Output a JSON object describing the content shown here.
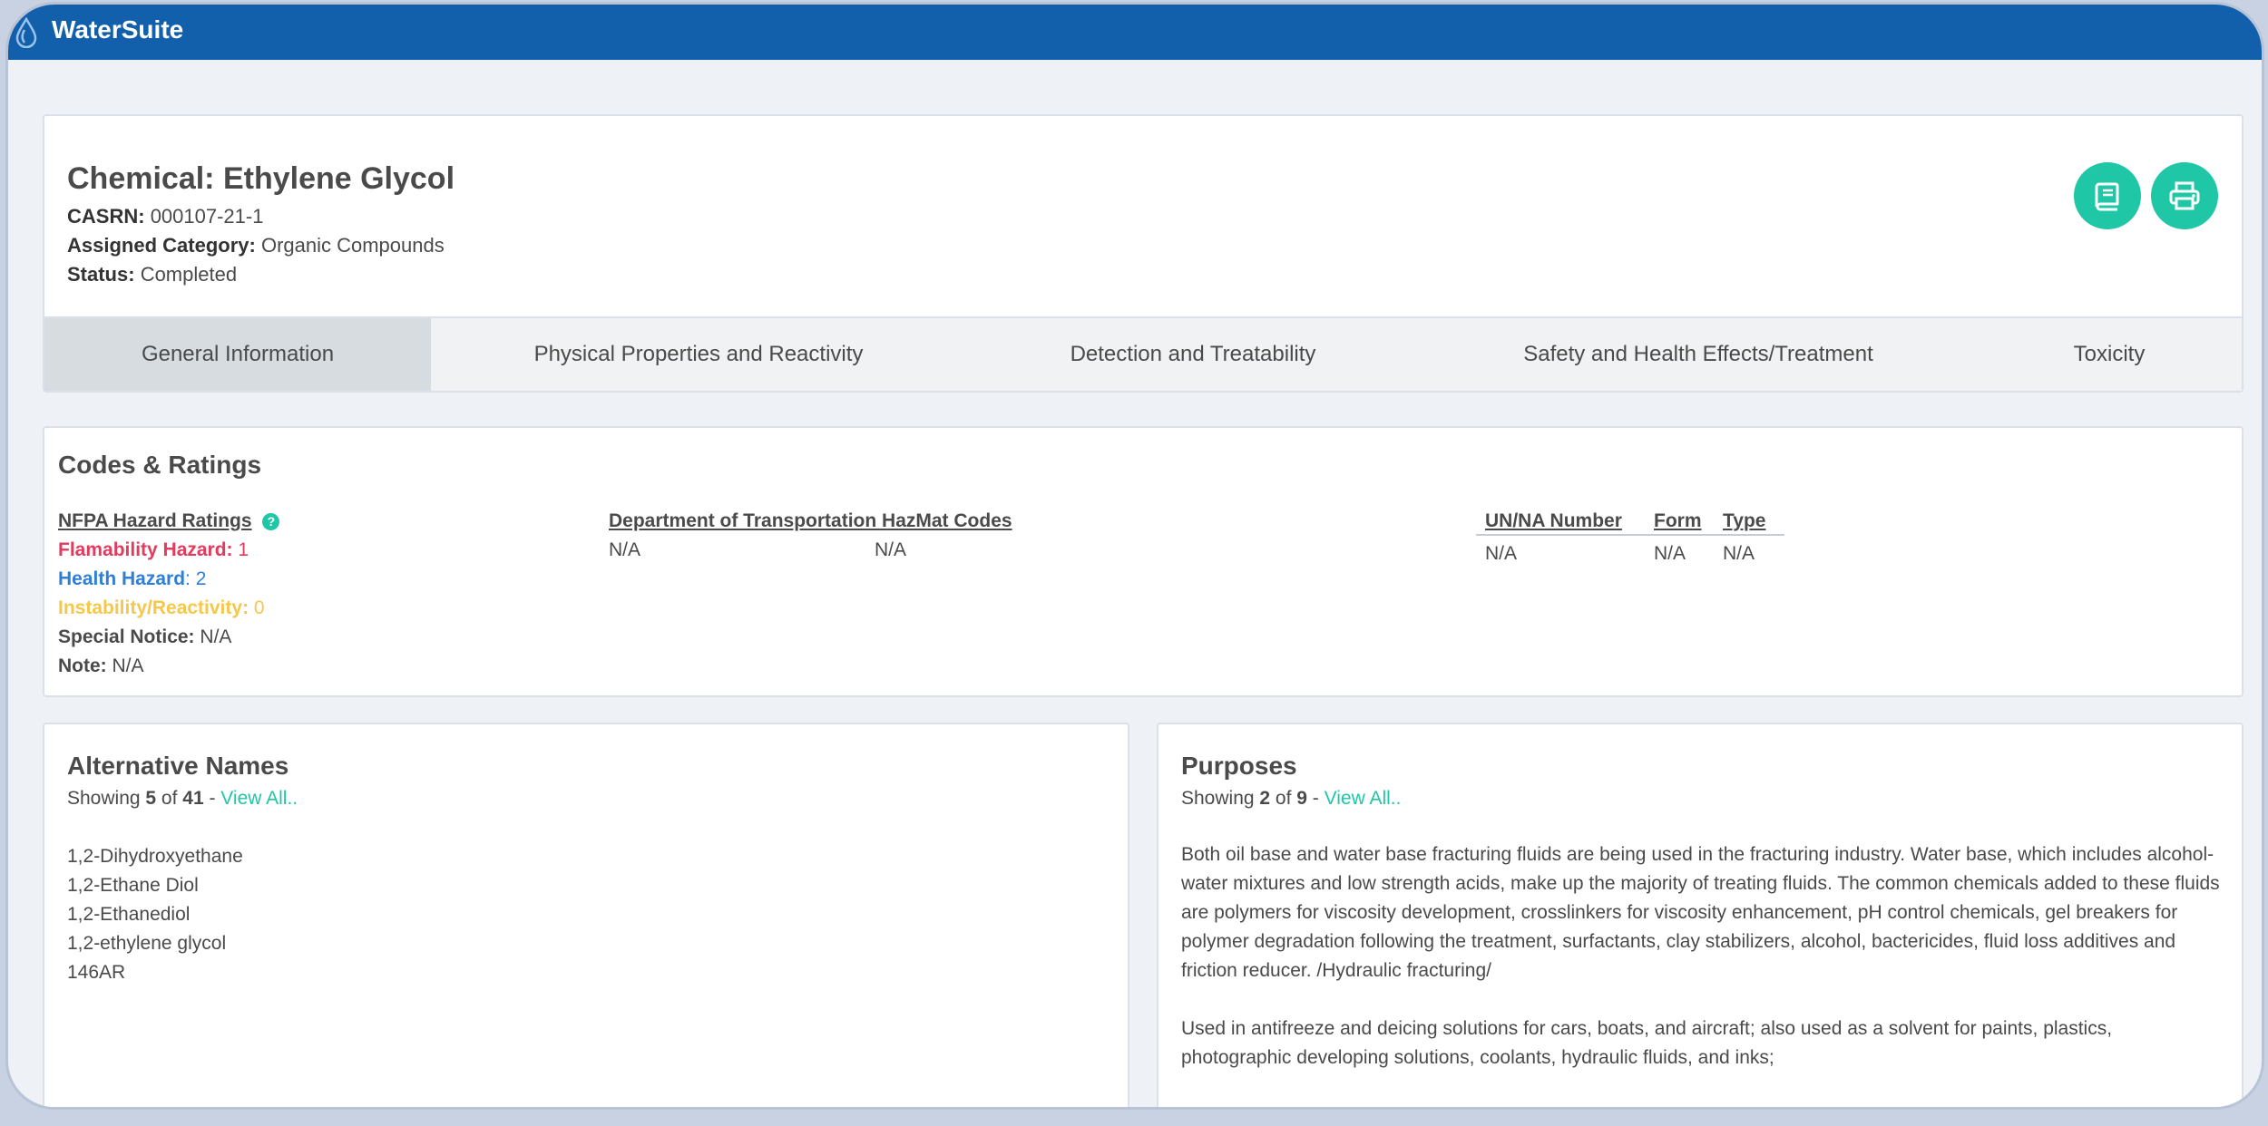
{
  "app": {
    "title": "WaterSuite"
  },
  "chemical": {
    "title": "Chemical: Ethylene Glycol",
    "casrn_label": "CASRN:",
    "casrn": "000107-21-1",
    "category_label": "Assigned Category:",
    "category": "Organic Compounds",
    "status_label": "Status:",
    "status": "Completed"
  },
  "tabs": [
    {
      "label": "General Information",
      "active": true
    },
    {
      "label": "Physical Properties and Reactivity",
      "active": false
    },
    {
      "label": "Detection and Treatability",
      "active": false
    },
    {
      "label": "Safety and Health Effects/Treatment",
      "active": false
    },
    {
      "label": "Toxicity",
      "active": false
    }
  ],
  "codes": {
    "title": "Codes & Ratings",
    "nfpa": {
      "heading": "NFPA Hazard Ratings",
      "flammability_label": "Flamability Hazard:",
      "flammability": "1",
      "health_label": "Health Hazard",
      "health": ": 2",
      "instability_label": "Instability/Reactivity:",
      "instability": "0",
      "special_label": "Special Notice:",
      "special": "N/A",
      "note_label": "Note:",
      "note": "N/A"
    },
    "dot": {
      "heading": "Department of Transportation HazMat Codes",
      "values": [
        "N/A",
        "N/A"
      ]
    },
    "un": {
      "headers": [
        "UN/NA Number",
        "Form",
        "Type"
      ],
      "row": [
        "N/A",
        "N/A",
        "N/A"
      ]
    }
  },
  "alt_names": {
    "title": "Alternative Names",
    "showing_prefix": "Showing ",
    "shown": "5",
    "of": " of ",
    "total": "41",
    "dash": " - ",
    "view_all": "View All..",
    "items": [
      "1,2-Dihydroxyethane",
      "1,2-Ethane Diol",
      "1,2-Ethanediol",
      "1,2-ethylene glycol",
      "146AR"
    ]
  },
  "purposes": {
    "title": "Purposes",
    "showing_prefix": "Showing ",
    "shown": "2",
    "of": " of ",
    "total": "9",
    "dash": " - ",
    "view_all": "View All..",
    "items": [
      "Both oil base and water base fracturing fluids are being used in the fracturing industry. Water base, which includes alcohol-water mixtures and low strength acids, make up the majority of treating fluids. The common chemicals added to these fluids are polymers for viscosity development, crosslinkers for viscosity enhancement, pH control chemicals, gel breakers for polymer degradation following the treatment, surfactants, clay stabilizers, alcohol, bactericides, fluid loss additives and friction reducer. /Hydraulic fracturing/",
      "Used in antifreeze and deicing solutions for cars, boats, and aircraft; also used as a solvent for paints, plastics, photographic developing solutions, coolants, hydraulic fluids, and inks;"
    ]
  },
  "colors": {
    "brand": "#125fab",
    "accent": "#1fc7a6",
    "flammability": "#e23b5e",
    "health": "#2f7ed8",
    "instability": "#f5c84b"
  },
  "icons": [
    "water-drop-logo-icon",
    "book-icon",
    "printer-icon",
    "help-icon"
  ]
}
